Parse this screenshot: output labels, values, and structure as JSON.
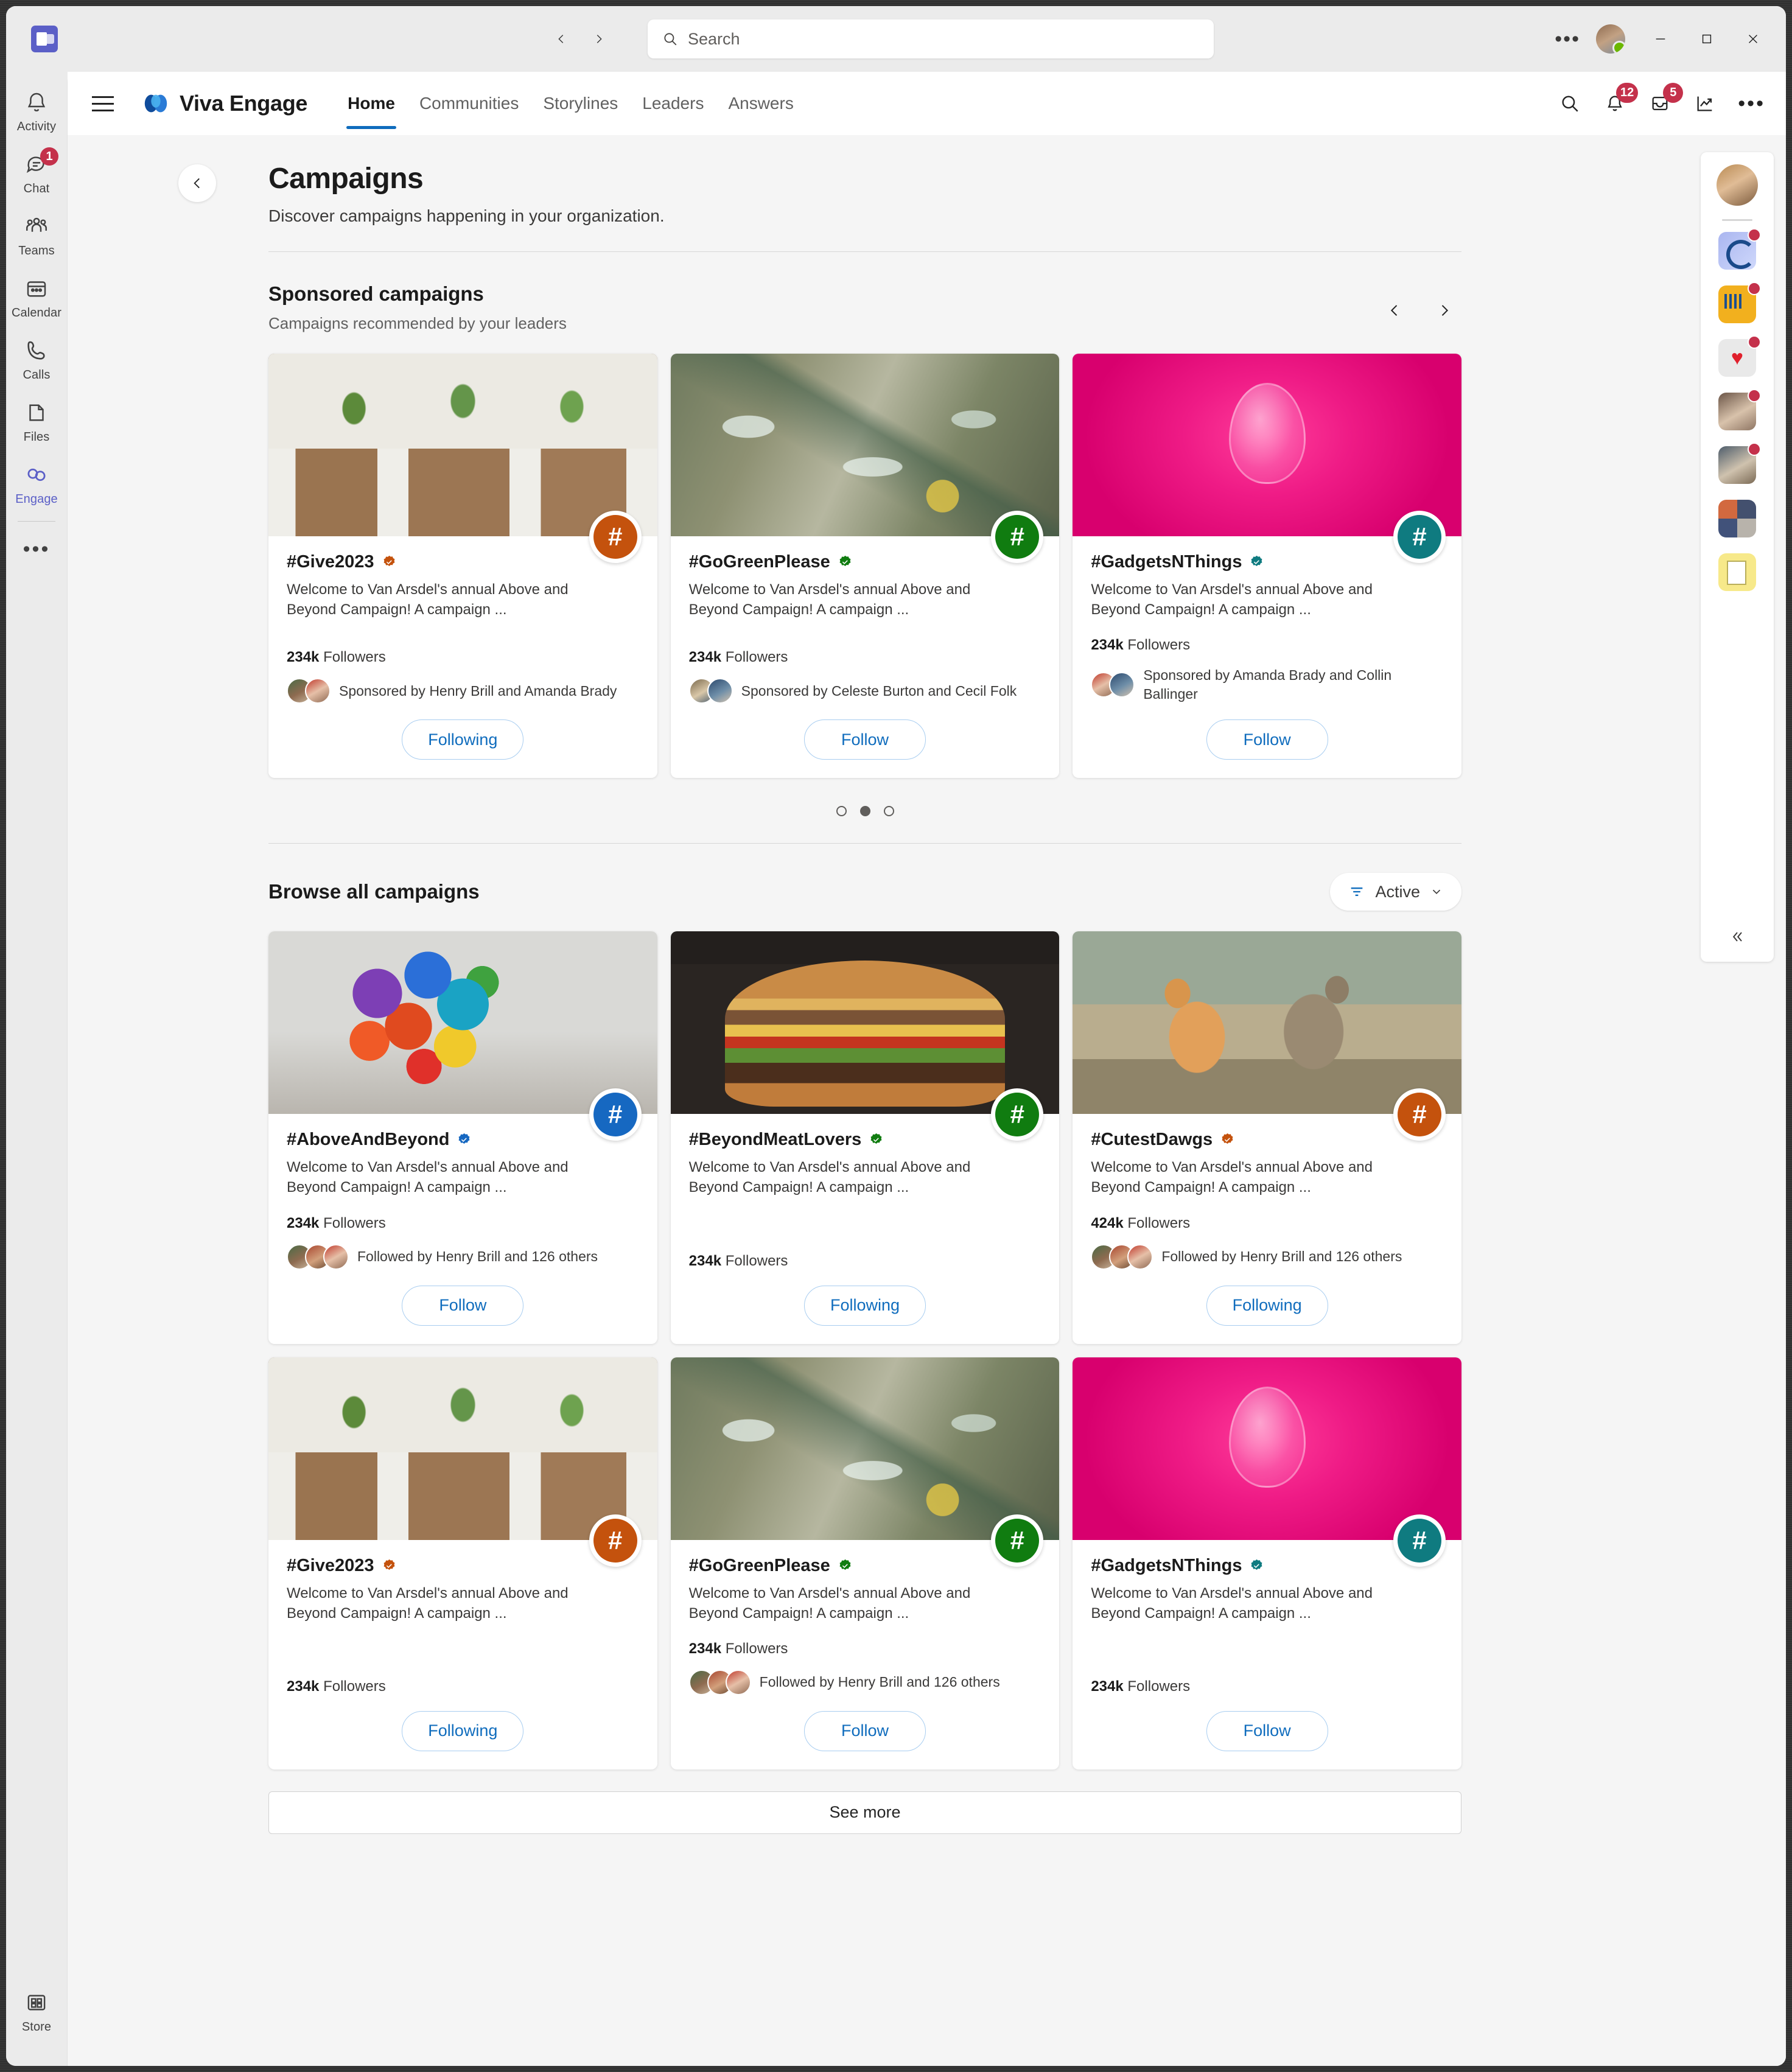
{
  "window": {
    "app": "Microsoft Teams",
    "search_placeholder": "Search",
    "back_icon": "chevron-left-icon",
    "forward_icon": "chevron-right-icon",
    "overflow_icon": "more-horizontal-icon",
    "minimize_icon": "minimize-icon",
    "maximize_icon": "maximize-icon",
    "close_icon": "close-icon"
  },
  "app_rail": {
    "items": [
      {
        "label": "Activity",
        "icon": "bell-icon",
        "badge": ""
      },
      {
        "label": "Chat",
        "icon": "chat-icon",
        "badge": "1"
      },
      {
        "label": "Teams",
        "icon": "teams-icon",
        "badge": ""
      },
      {
        "label": "Calendar",
        "icon": "calendar-icon",
        "badge": ""
      },
      {
        "label": "Calls",
        "icon": "phone-icon",
        "badge": ""
      },
      {
        "label": "Files",
        "icon": "file-icon",
        "badge": ""
      },
      {
        "label": "Engage",
        "icon": "engage-icon",
        "badge": "",
        "active": true
      }
    ],
    "more_label": "•••",
    "store": {
      "label": "Store",
      "icon": "store-icon"
    }
  },
  "app_header": {
    "menu_icon": "hamburger-icon",
    "logo_icon": "viva-engage-logo",
    "brand": "Viva Engage",
    "tabs": [
      {
        "label": "Home",
        "active": true
      },
      {
        "label": "Communities",
        "active": false
      },
      {
        "label": "Storylines",
        "active": false
      },
      {
        "label": "Leaders",
        "active": false
      },
      {
        "label": "Answers",
        "active": false
      }
    ],
    "actions": [
      {
        "icon": "search-icon",
        "badge": ""
      },
      {
        "icon": "bell-icon",
        "badge": "12"
      },
      {
        "icon": "inbox-icon",
        "badge": "5"
      },
      {
        "icon": "analytics-icon",
        "badge": ""
      }
    ],
    "overflow_label": "•••"
  },
  "page": {
    "back_icon": "chevron-left-icon",
    "title": "Campaigns",
    "subtitle": "Discover campaigns happening in your organization."
  },
  "sponsored": {
    "title": "Sponsored campaigns",
    "subtitle": "Campaigns recommended by your leaders",
    "prev_icon": "chevron-left-icon",
    "next_icon": "chevron-right-icon",
    "carousel": {
      "total": 3,
      "active_index": 1
    },
    "cards": [
      {
        "title": "#Give2023",
        "verified": true,
        "description": "Welcome to Van Arsdel's annual Above and Beyond Campaign! A campaign ...",
        "followers_count": "234k",
        "followers_label": "Followers",
        "people_text": "Sponsored by Henry Brill and Amanda Brady",
        "avatar_count": 2,
        "button": "Following",
        "accent": "#c4520d",
        "image": "seedlings-in-pots"
      },
      {
        "title": "#GoGreenPlease",
        "verified": true,
        "description": "Welcome to Van Arsdel's annual Above and Beyond Campaign! A campaign ...",
        "followers_count": "234k",
        "followers_label": "Followers",
        "people_text": "Sponsored by Celeste Burton and Cecil Folk",
        "avatar_count": 2,
        "button": "Follow",
        "accent": "#107c10",
        "image": "plastic-bottles-waste"
      },
      {
        "title": "#GadgetsNThings",
        "verified": true,
        "description": "Welcome to Van Arsdel's annual Above and Beyond Campaign! A campaign ...",
        "followers_count": "234k",
        "followers_label": "Followers",
        "people_text": "Sponsored by Amanda Brady and Collin Ballinger",
        "avatar_count": 2,
        "button": "Follow",
        "accent": "#0f7b80",
        "image": "pink-lightbulb"
      }
    ]
  },
  "browse": {
    "title": "Browse all campaigns",
    "filter": {
      "icon": "filter-icon",
      "label": "Active",
      "chevron": "chevron-down-icon"
    },
    "cards": [
      {
        "title": "#AboveAndBeyond",
        "verified": true,
        "description": "Welcome to Van Arsdel's annual Above and Beyond Campaign! A campaign ...",
        "followers_count": "234k",
        "followers_label": "Followers",
        "people_text": "Followed by Henry Brill and 126 others",
        "avatar_count": 3,
        "button": "Follow",
        "accent": "#1668c1",
        "image": "colorful-balloons"
      },
      {
        "title": "#BeyondMeatLovers",
        "verified": true,
        "description": "Welcome to Van Arsdel's annual Above and Beyond Campaign! A campaign ...",
        "followers_count": "234k",
        "followers_label": "Followers",
        "people_text": "",
        "avatar_count": 0,
        "button": "Following",
        "accent": "#107c10",
        "image": "cheeseburger"
      },
      {
        "title": "#CutestDawgs",
        "verified": true,
        "description": "Welcome to Van Arsdel's annual Above and Beyond Campaign! A campaign ...",
        "followers_count": "424k",
        "followers_label": "Followers",
        "people_text": "Followed by Henry Brill and 126 others",
        "avatar_count": 3,
        "button": "Following",
        "accent": "#c4520d",
        "image": "two-dogs-running"
      },
      {
        "title": "#Give2023",
        "verified": true,
        "description": "Welcome to Van Arsdel's annual Above and Beyond Campaign! A campaign ...",
        "followers_count": "234k",
        "followers_label": "Followers",
        "people_text": "",
        "avatar_count": 0,
        "button": "Following",
        "accent": "#c4520d",
        "image": "seedlings-in-pots"
      },
      {
        "title": "#GoGreenPlease",
        "verified": true,
        "description": "Welcome to Van Arsdel's annual Above and Beyond Campaign! A campaign ...",
        "followers_count": "234k",
        "followers_label": "Followers",
        "people_text": "Followed by Henry Brill and 126 others",
        "avatar_count": 3,
        "button": "Follow",
        "accent": "#107c10",
        "image": "plastic-bottles-waste"
      },
      {
        "title": "#GadgetsNThings",
        "verified": true,
        "description": "Welcome to Van Arsdel's annual Above and Beyond Campaign! A campaign ...",
        "followers_count": "234k",
        "followers_label": "Followers",
        "people_text": "",
        "avatar_count": 0,
        "button": "Follow",
        "accent": "#0f7b80",
        "image": "pink-lightbulb"
      }
    ],
    "see_more": "See more"
  },
  "right_rail": {
    "avatar": "user-avatar",
    "apps": [
      {
        "icon": "viva-connections-icon",
        "badge": true
      },
      {
        "icon": "presentation-icon",
        "badge": true
      },
      {
        "icon": "heart-icon",
        "badge": true
      },
      {
        "icon": "person-photo-icon",
        "badge": true
      },
      {
        "icon": "person-laptop-icon",
        "badge": true
      },
      {
        "icon": "people-grid-icon",
        "badge": false
      },
      {
        "icon": "documents-icon",
        "badge": false
      }
    ],
    "collapse_icon": "chevron-double-left-icon"
  },
  "colors": {
    "accent_blue": "#0f6cbd",
    "teams_purple": "#5b5fc7",
    "badge_red": "#c4314b"
  }
}
